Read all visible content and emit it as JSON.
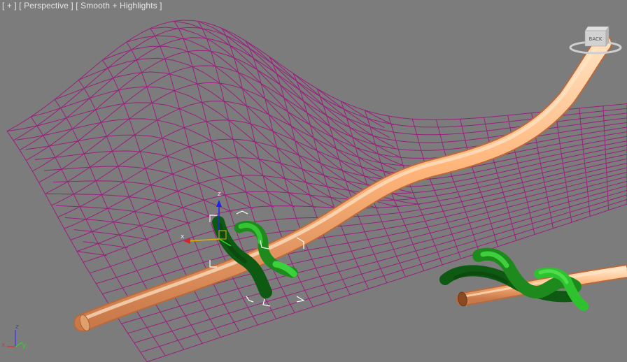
{
  "viewport": {
    "label": {
      "plus": "[ + ]",
      "view": "[ Perspective ]",
      "shading": "[ Smooth + Highlights ]"
    },
    "viewcube": {
      "face_label": "BACK"
    }
  },
  "gizmo": {
    "x_label": "x",
    "z_label": "z"
  },
  "world_axis": {
    "x_label": "x",
    "y_label": "y",
    "z_label": "z"
  },
  "colors": {
    "background": "#7c7c7c",
    "wire_mesh": "#9a1f7e",
    "tube_light": "#ffc48f",
    "tube_dark": "#c97a45",
    "vine_dark": "#0f5a12",
    "vine_light": "#2fc22f",
    "axis_x": "#e22",
    "axis_y": "#1d1",
    "axis_z": "#22e",
    "gizmo_x": "#e2b100",
    "selection": "#ffffff"
  }
}
